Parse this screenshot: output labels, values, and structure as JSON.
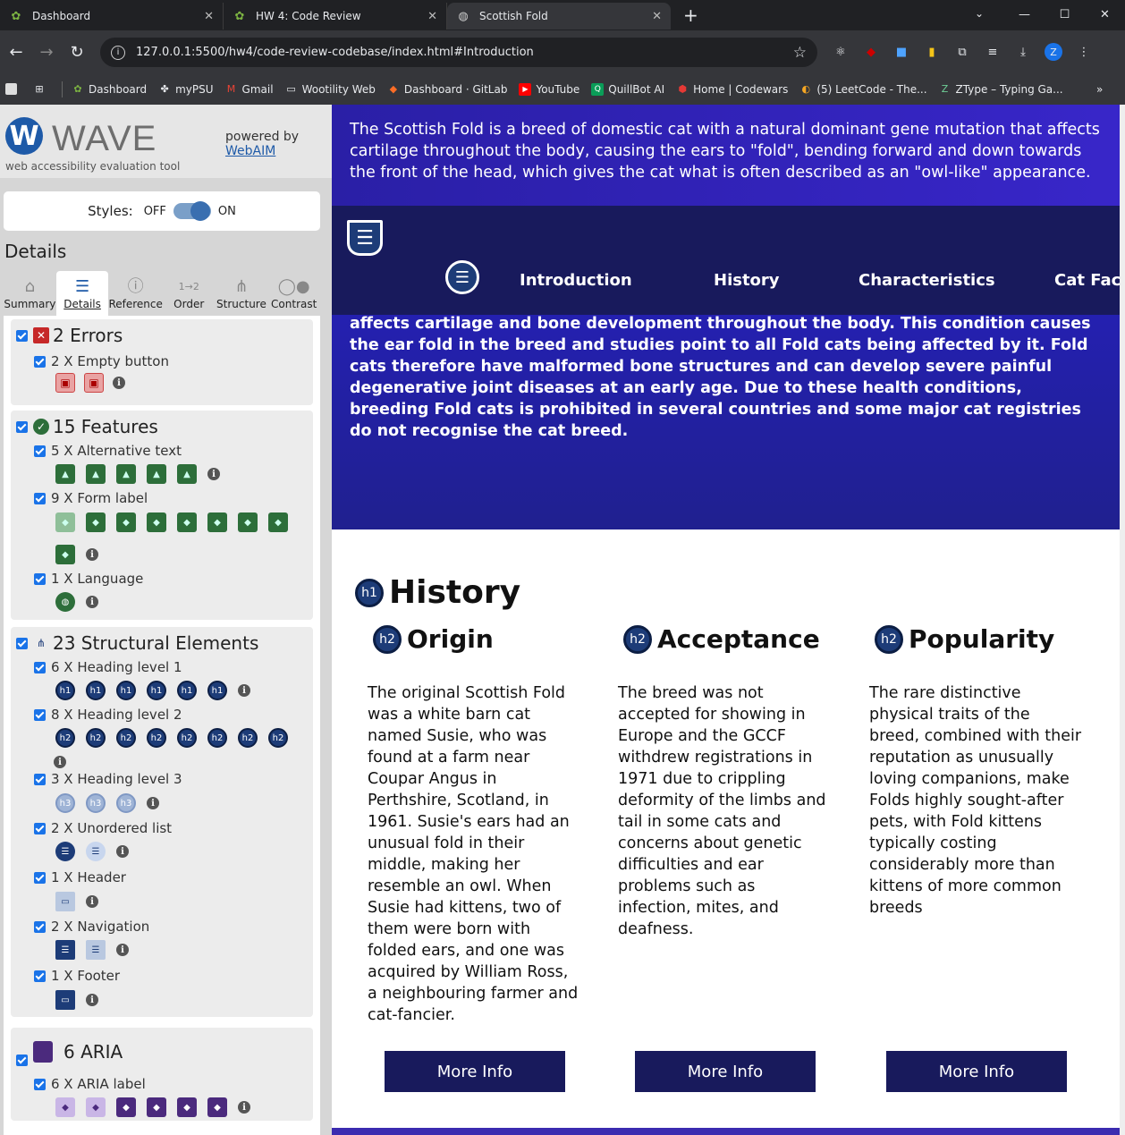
{
  "browser": {
    "tabs": [
      {
        "title": "Dashboard",
        "icon": "gitlab-flower-icon"
      },
      {
        "title": "HW 4: Code Review",
        "icon": "gitlab-flower-icon"
      },
      {
        "title": "Scottish Fold",
        "icon": "globe-icon",
        "active": true
      }
    ],
    "url": "127.0.0.1:5500/hw4/code-review-codebase/index.html#Introduction",
    "bookmarks": [
      "Dashboard",
      "myPSU",
      "Gmail",
      "Wootility Web",
      "Dashboard · GitLab",
      "YouTube",
      "QuillBot AI",
      "Home | Codewars",
      "(5) LeetCode - The...",
      "ZType – Typing Ga..."
    ],
    "profile_initial": "Z"
  },
  "wave": {
    "logo_letter": "W",
    "name": "WAVE",
    "subtitle": "web accessibility evaluation tool",
    "powered_by": "powered by",
    "webaim": "WebAIM",
    "styles_label": "Styles:",
    "styles_off": "OFF",
    "styles_on": "ON",
    "details_heading": "Details",
    "tabs": [
      "Summary",
      "Details",
      "Reference",
      "Order",
      "Structure",
      "Contrast"
    ],
    "errors": {
      "title": "2 Errors",
      "items": [
        {
          "label": "2 X Empty button"
        }
      ]
    },
    "features": {
      "title": "15 Features",
      "items": [
        {
          "label": "5 X Alternative text"
        },
        {
          "label": "9 X Form label"
        },
        {
          "label": "1 X Language"
        }
      ]
    },
    "structure": {
      "title": "23 Structural Elements",
      "items": [
        {
          "label": "6 X Heading level 1"
        },
        {
          "label": "8 X Heading level 2"
        },
        {
          "label": "3 X Heading level 3"
        },
        {
          "label": "2 X Unordered list"
        },
        {
          "label": "1 X Header"
        },
        {
          "label": "2 X Navigation"
        },
        {
          "label": "1 X Footer"
        }
      ]
    },
    "aria": {
      "title": "6 ARIA",
      "items": [
        {
          "label": "6 X ARIA label"
        }
      ]
    },
    "icon_text": {
      "h1": "h1",
      "h2": "h2",
      "h3": "h3",
      "info": "i"
    }
  },
  "page": {
    "intro_top": "The Scottish Fold is a breed of domestic cat with a natural dominant gene mutation that affects cartilage throughout the body, causing the ears to \"fold\", bending forward and down towards the front of the head, which gives the cat what is often described as an \"owl-like\" appearance.",
    "nav": [
      "Introduction",
      "History",
      "Characteristics",
      "Cat Facts"
    ],
    "intro_bottom": "affects cartilage and bone development throughout the body. This condition causes the ear fold in the breed and studies point to all Fold cats being affected by it. Fold cats therefore have malformed bone structures and can develop severe painful degenerative joint diseases at an early age. Due to these health conditions, breeding Fold cats is prohibited in several countries and some major cat registries do not recognise the cat breed.",
    "history_heading": "History",
    "columns": [
      {
        "title": "Origin",
        "text": "The original Scottish Fold was a white barn cat named Susie, who was found at a farm near Coupar Angus in Perthshire, Scotland, in 1961. Susie's ears had an unusual fold in their middle, making her resemble an owl. When Susie had kittens, two of them were born with folded ears, and one was acquired by William Ross, a neighbouring farmer and cat-fancier.",
        "button": "More Info"
      },
      {
        "title": "Acceptance",
        "text": "The breed was not accepted for showing in Europe and the GCCF withdrew registrations in 1971 due to crippling deformity of the limbs and tail in some cats and concerns about genetic difficulties and ear problems such as infection, mites, and deafness.",
        "button": "More Info"
      },
      {
        "title": "Popularity",
        "text": "The rare distinctive physical traits of the breed, combined with their reputation as unusually loving companions, make Folds highly sought-after pets, with Fold kittens typically costing considerably more than kittens of more common breeds",
        "button": "More Info"
      }
    ]
  }
}
